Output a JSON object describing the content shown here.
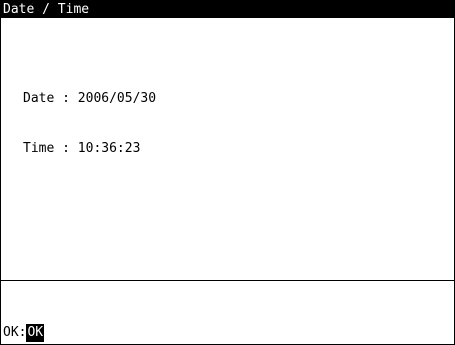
{
  "window": {
    "title": "Date / Time"
  },
  "fields": {
    "date": {
      "label": "Date",
      "separator": ":",
      "value": "2006/05/30"
    },
    "time": {
      "label": "Time",
      "separator": ":",
      "value": "10:36:23"
    }
  },
  "softkeys": {
    "ok_prompt": "OK:",
    "ok_label": "OK"
  },
  "colors": {
    "foreground": "#000000",
    "background": "#ffffff",
    "title_bar": "#000000",
    "highlight": "#000000"
  }
}
